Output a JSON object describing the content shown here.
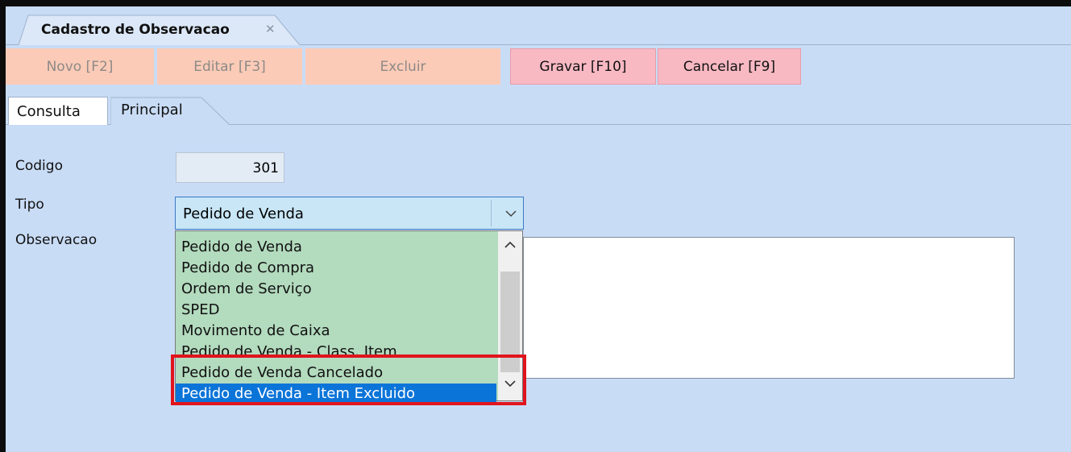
{
  "window": {
    "doc_tab_title": "Cadastro de Observacao",
    "doc_tab_close_icon": "close-icon"
  },
  "toolbar": {
    "novo": "Novo [F2]",
    "editar": "Editar [F3]",
    "excluir": "Excluir",
    "gravar": "Gravar [F10]",
    "cancelar": "Cancelar [F9]"
  },
  "tabs": {
    "consulta": "Consulta",
    "principal": "Principal"
  },
  "form": {
    "codigo_label": "Codigo",
    "codigo_value": "301",
    "tipo_label": "Tipo",
    "tipo_value": "Pedido de Venda",
    "observacao_label": "Observacao",
    "observacao_value": ""
  },
  "dropdown": {
    "items": [
      {
        "label": "Pedido de Venda",
        "selected": false
      },
      {
        "label": "Pedido de Compra",
        "selected": false
      },
      {
        "label": "Ordem de Serviço",
        "selected": false
      },
      {
        "label": "SPED",
        "selected": false
      },
      {
        "label": "Movimento de Caixa",
        "selected": false
      },
      {
        "label": "Pedido de Venda - Class. Item",
        "selected": false
      },
      {
        "label": "Pedido de Venda Cancelado",
        "selected": false
      },
      {
        "label": "Pedido de Venda - Item Excluido",
        "selected": true
      }
    ],
    "up_icon": "chevron-up-icon",
    "down_icon": "chevron-down-icon"
  },
  "colors": {
    "background": "#c9dcf6",
    "disabled_button": "#fbcbb8",
    "active_button": "#f8b9c3",
    "dropdown_bg": "#b3dbbe",
    "selection": "#0b74d8",
    "highlight": "#e1141d"
  }
}
